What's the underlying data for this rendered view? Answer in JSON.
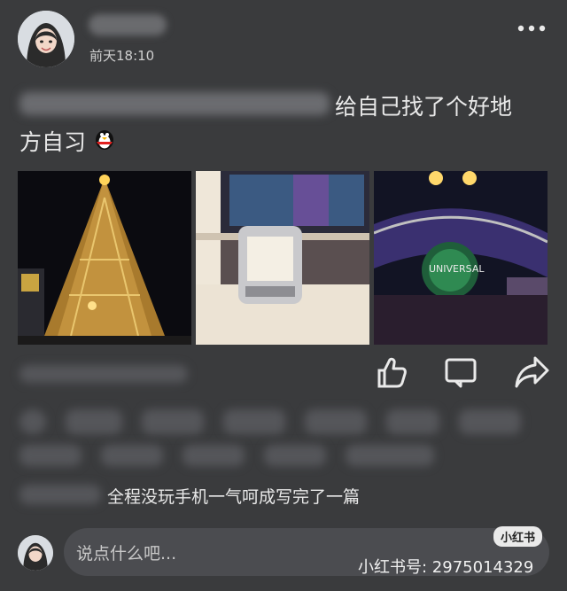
{
  "post": {
    "time": "前天18:10",
    "text_visible_line1": "给自己找了个好地",
    "text_visible_line2": "方自习",
    "caption_visible": "全程没玩手机一气呵成写完了一篇"
  },
  "composer": {
    "placeholder": "说点什么吧..."
  },
  "watermark": {
    "badge": "小红书",
    "id": "小红书号: 2975014329"
  },
  "icons": {
    "more": "more-dots-icon",
    "like": "thumbs-up-icon",
    "comment": "comment-icon",
    "share": "share-icon",
    "emoji": "penguin-emoji-icon"
  },
  "colors": {
    "background": "#3a3b3d",
    "input_bg": "#4b4c50",
    "text": "#e9e9e9"
  }
}
